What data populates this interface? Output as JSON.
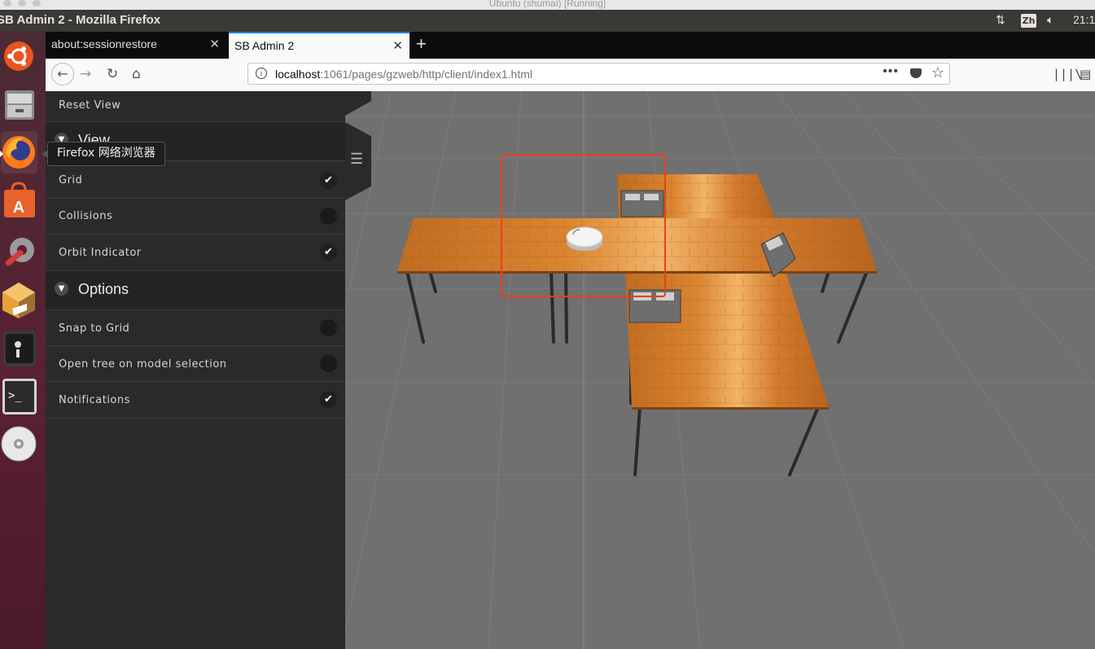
{
  "vm_window": {
    "title": "Ubuntu (shumai) [Running]"
  },
  "top_panel": {
    "window_title": "SB Admin 2 - Mozilla Firefox",
    "input_method": "Zh",
    "clock": "21:1"
  },
  "launcher": {
    "items": [
      {
        "name": "ubuntu-dash-icon"
      },
      {
        "name": "files-icon"
      },
      {
        "name": "firefox-icon"
      },
      {
        "name": "software-center-icon"
      },
      {
        "name": "system-settings-icon"
      },
      {
        "name": "virtualbox-icon"
      },
      {
        "name": "disk-icon"
      },
      {
        "name": "terminal-icon"
      },
      {
        "name": "dvd-icon"
      }
    ],
    "tooltip": "Firefox 网络浏览器"
  },
  "browser": {
    "tabs": [
      {
        "label": "about:sessionrestore",
        "active": false
      },
      {
        "label": "SB Admin 2",
        "active": true
      }
    ],
    "url_host": "localhost",
    "url_path": ":1061/pages/gzweb/http/client/index1.html"
  },
  "sidebar": {
    "reset_view": "Reset View",
    "view_section": "View",
    "view_items": [
      {
        "label": "Grid",
        "checked": true
      },
      {
        "label": "Collisions",
        "checked": false
      },
      {
        "label": "Orbit Indicator",
        "checked": true
      }
    ],
    "options_section": "Options",
    "options_items": [
      {
        "label": "Snap to Grid",
        "checked": false
      },
      {
        "label": "Open tree on model selection",
        "checked": false
      },
      {
        "label": "Notifications",
        "checked": true
      }
    ]
  },
  "colors": {
    "accent": "#0a84ff",
    "selection_box": "#e8401c",
    "table_wood": "#d9842f",
    "ground": "#707070"
  }
}
